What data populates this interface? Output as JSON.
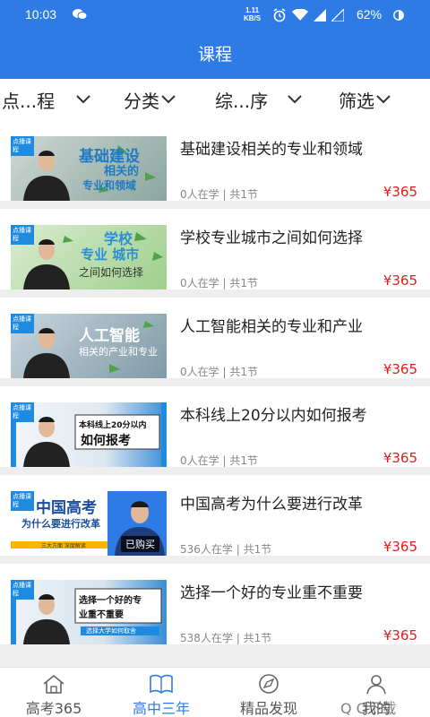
{
  "status_bar": {
    "time": "10:03",
    "net_speed_value": "1.11",
    "net_speed_unit": "KB/S",
    "battery": "62%"
  },
  "header": {
    "title": "课程"
  },
  "filters": [
    {
      "label": "点...程"
    },
    {
      "label": "分类"
    },
    {
      "label": "综...序"
    },
    {
      "label": "筛选"
    }
  ],
  "courses": [
    {
      "badge": "点播课程",
      "thumb_lines": [
        "基础建设",
        "相关的",
        "专业和领域"
      ],
      "title": "基础建设相关的专业和领域",
      "learners": "0人在学",
      "lessons": "共1节",
      "price": "¥365"
    },
    {
      "badge": "点播课程",
      "thumb_lines": [
        "学校",
        "专业 城市",
        "之间如何选择"
      ],
      "title": "学校专业城市之间如何选择",
      "learners": "0人在学",
      "lessons": "共1节",
      "price": "¥365"
    },
    {
      "badge": "点播课程",
      "thumb_lines": [
        "人工智能",
        "相关的产业和专业"
      ],
      "title": "人工智能相关的专业和产业",
      "learners": "0人在学",
      "lessons": "共1节",
      "price": "¥365"
    },
    {
      "badge": "点播课程",
      "thumb_lines": [
        "本科线上20分以内",
        "如何报考"
      ],
      "title": "本科线上20分以内如何报考",
      "learners": "0人在学",
      "lessons": "共1节",
      "price": "¥365"
    },
    {
      "badge": "点播课程",
      "thumb_lines": [
        "中国高考",
        "为什么要进行改革",
        "三大方面 深度解读"
      ],
      "sold_label": "已购买",
      "title": "中国高考为什么要进行改革",
      "learners": "536人在学",
      "lessons": "共1节",
      "price": "¥365"
    },
    {
      "badge": "点播课程",
      "thumb_lines": [
        "选择一个好的专",
        "业重不重要",
        "选择大学如何取舍"
      ],
      "title": "选择一个好的专业重不重要",
      "learners": "538人在学",
      "lessons": "共1节",
      "price": "¥365"
    }
  ],
  "tabs": [
    {
      "label": "高考365",
      "icon": "home-icon"
    },
    {
      "label": "高中三年",
      "icon": "book-icon"
    },
    {
      "label": "精品发现",
      "icon": "compass-icon"
    },
    {
      "label": "我的",
      "icon": "user-icon"
    }
  ],
  "watermark": "Q Q下载",
  "colors": {
    "primary": "#2e7be6",
    "price": "#e01d1d"
  }
}
